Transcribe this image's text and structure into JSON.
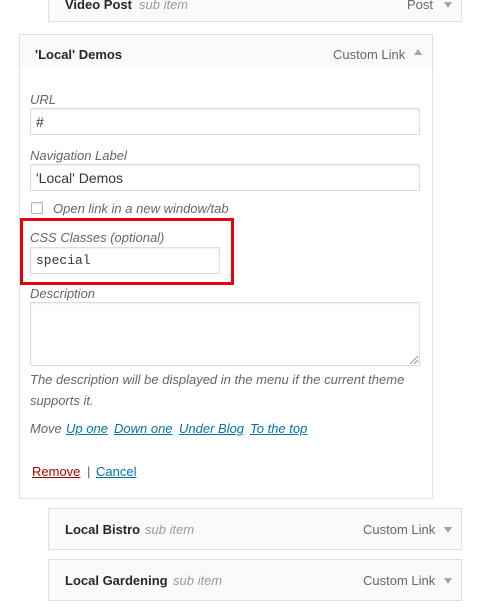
{
  "items": {
    "video_post": {
      "title": "Video Post",
      "sub": "sub item",
      "type": "Post"
    },
    "local_demos": {
      "title": "'Local' Demos",
      "type": "Custom Link"
    },
    "local_bistro": {
      "title": "Local Bistro",
      "sub": "sub item",
      "type": "Custom Link"
    },
    "local_gardening": {
      "title": "Local Gardening",
      "sub": "sub item",
      "type": "Custom Link"
    }
  },
  "form": {
    "url_label": "URL",
    "url_value": "#",
    "nav_label_label": "Navigation Label",
    "nav_label_value": "'Local' Demos",
    "open_new_tab_label": "Open link in a new window/tab",
    "css_label": "CSS Classes (optional)",
    "css_value": "special",
    "description_label": "Description",
    "description_value": "",
    "description_help": "The description will be displayed in the menu if the current theme supports it.",
    "move_label": "Move",
    "move_links": [
      "Up one",
      "Down one",
      "Under Blog",
      "To the top"
    ],
    "remove_label": "Remove",
    "separator": "|",
    "cancel_label": "Cancel"
  },
  "colors": {
    "highlight": "#e3000f",
    "link": "#0073aa",
    "remove": "#aa0000"
  }
}
